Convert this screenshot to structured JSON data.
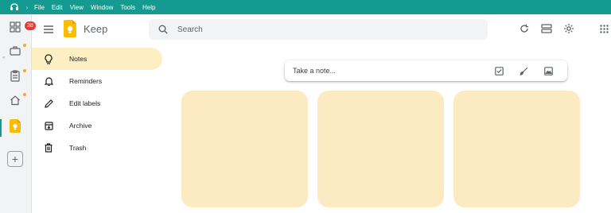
{
  "menubar": {
    "items": [
      "File",
      "Edit",
      "View",
      "Window",
      "Tools",
      "Help"
    ],
    "app_icon": "app-logo-icon",
    "background": "#149a91"
  },
  "rail": {
    "badge_count": "38",
    "items": [
      "apps-grid-icon",
      "briefcase-icon",
      "clipboard-icon",
      "home-icon",
      "keep-app-icon"
    ],
    "add_icon": "plus-icon",
    "accent_dot_color": "#f9a825"
  },
  "header": {
    "title": "Keep",
    "search_placeholder": "Search",
    "icons": [
      "refresh-icon",
      "list-view-icon",
      "settings-icon",
      "apps-icon"
    ]
  },
  "nav": {
    "items": [
      {
        "label": "Notes",
        "icon": "lightbulb-icon",
        "active": true
      },
      {
        "label": "Reminders",
        "icon": "bell-icon"
      },
      {
        "label": "Edit labels",
        "icon": "pencil-icon"
      },
      {
        "label": "Archive",
        "icon": "archive-icon"
      },
      {
        "label": "Trash",
        "icon": "trash-icon"
      }
    ]
  },
  "take_note": {
    "placeholder": "Take a note...",
    "icons": [
      "checkbox-icon",
      "brush-icon",
      "image-icon"
    ]
  },
  "colors": {
    "active_nav": "#feefc3",
    "note_card": "#fcebc2",
    "keep_yellow": "#fbbc04"
  }
}
